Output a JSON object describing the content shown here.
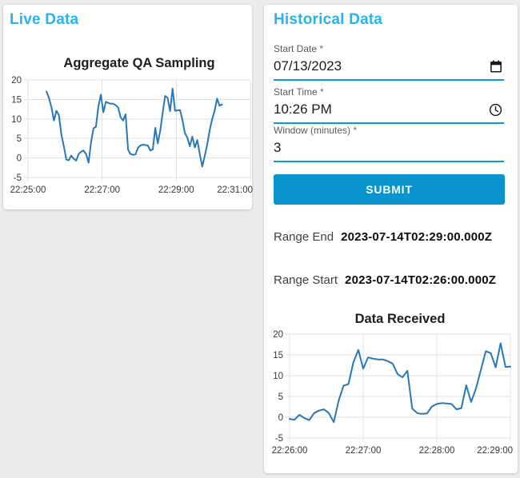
{
  "live_panel": {
    "title": "Live Data"
  },
  "historical_panel": {
    "title": "Historical Data",
    "fields": [
      {
        "label": "Start Date",
        "required": "*",
        "value": "07/13/2023",
        "icon": "calendar-icon"
      },
      {
        "label": "Start Time",
        "required": "*",
        "value": "10:26 PM",
        "icon": "clock-icon"
      },
      {
        "label": "Window (minutes)",
        "required": "*",
        "value": "3",
        "icon": ""
      }
    ],
    "submit_label": "SUBMIT",
    "range_end": {
      "label": "Range End",
      "value": "2023-07-14T02:29:00.000Z"
    },
    "range_start": {
      "label": "Range Start",
      "value": "2023-07-14T02:26:00.000Z"
    }
  },
  "colors": {
    "page_background": "#ececec",
    "card_background": "#ffffff",
    "heading_blue": "#29b2ef",
    "button_blue": "#0a94cd",
    "field_underline_blue": "#1598d6",
    "chart_line_blue": "#2878b8",
    "gridline_gray": "#e2e2e2"
  },
  "chart_data": [
    {
      "id": "live",
      "type": "line",
      "title": "Aggregate QA Sampling",
      "xlabel": "",
      "ylabel": "",
      "grid": true,
      "legend": false,
      "line_color": "#2878b8",
      "x_axis": {
        "unit": "time",
        "range_s": [
          0,
          360
        ],
        "ticks": [
          {
            "s": 0,
            "label": "22:25:00"
          },
          {
            "s": 120,
            "label": "22:27:00"
          },
          {
            "s": 240,
            "label": "22:29:00"
          },
          {
            "s": 360,
            "label": "22:31:00"
          }
        ]
      },
      "y_axis": {
        "range": [
          -5,
          20
        ],
        "ticks": [
          20,
          15,
          10,
          5,
          0,
          -5
        ]
      },
      "series": [
        {
          "name": "aggregate-qa-sampling",
          "start_s": 30,
          "step_s": 4,
          "values": [
            17.0,
            15.3,
            13.0,
            9.6,
            12.1,
            11.0,
            6.0,
            3.0,
            -0.4,
            -0.6,
            0.6,
            -0.2,
            -0.7,
            1.0,
            1.6,
            1.9,
            1.0,
            -1.2,
            4.0,
            7.6,
            8.0,
            13.2,
            16.2,
            11.7,
            14.4,
            14.1,
            13.9,
            13.9,
            13.5,
            12.9,
            10.4,
            9.6,
            11.2,
            2.1,
            1.0,
            0.8,
            0.9,
            2.6,
            3.2,
            3.4,
            3.3,
            3.2,
            1.9,
            2.2,
            7.7,
            3.7,
            7.0,
            11.5,
            15.9,
            15.4,
            12.0,
            17.8,
            12.1,
            12.2,
            12.3,
            9.7,
            6.4,
            5.2,
            3.0,
            5.5,
            2.7,
            4.6,
            1.0,
            -2.2,
            0.5,
            3.3,
            7.0,
            9.9,
            12.0,
            15.2,
            13.4,
            13.7
          ]
        }
      ]
    },
    {
      "id": "historical",
      "type": "line",
      "title": "Data Received",
      "xlabel": "",
      "ylabel": "",
      "grid": true,
      "legend": false,
      "line_color": "#2878b8",
      "x_axis": {
        "unit": "time",
        "range_s": [
          0,
          180
        ],
        "ticks": [
          {
            "s": 0,
            "label": "22:26:00"
          },
          {
            "s": 60,
            "label": "22:27:00"
          },
          {
            "s": 120,
            "label": "22:28:00"
          },
          {
            "s": 180,
            "label": "22:29:00"
          }
        ]
      },
      "y_axis": {
        "range": [
          -5,
          20
        ],
        "ticks": [
          20,
          15,
          10,
          5,
          0,
          -5
        ]
      },
      "series": [
        {
          "name": "data-received",
          "start_s": 0,
          "step_s": 4,
          "values": [
            -0.4,
            -0.6,
            0.6,
            -0.2,
            -0.7,
            1.0,
            1.6,
            1.9,
            1.0,
            -1.2,
            4.0,
            7.6,
            8.0,
            13.2,
            16.2,
            11.7,
            14.4,
            14.1,
            13.9,
            13.9,
            13.5,
            12.9,
            10.4,
            9.6,
            11.2,
            2.1,
            1.0,
            0.8,
            0.9,
            2.6,
            3.2,
            3.4,
            3.3,
            3.2,
            1.9,
            2.2,
            7.7,
            3.7,
            7.0,
            11.5,
            15.9,
            15.4,
            12.0,
            17.8,
            12.1,
            12.2
          ]
        }
      ]
    }
  ]
}
